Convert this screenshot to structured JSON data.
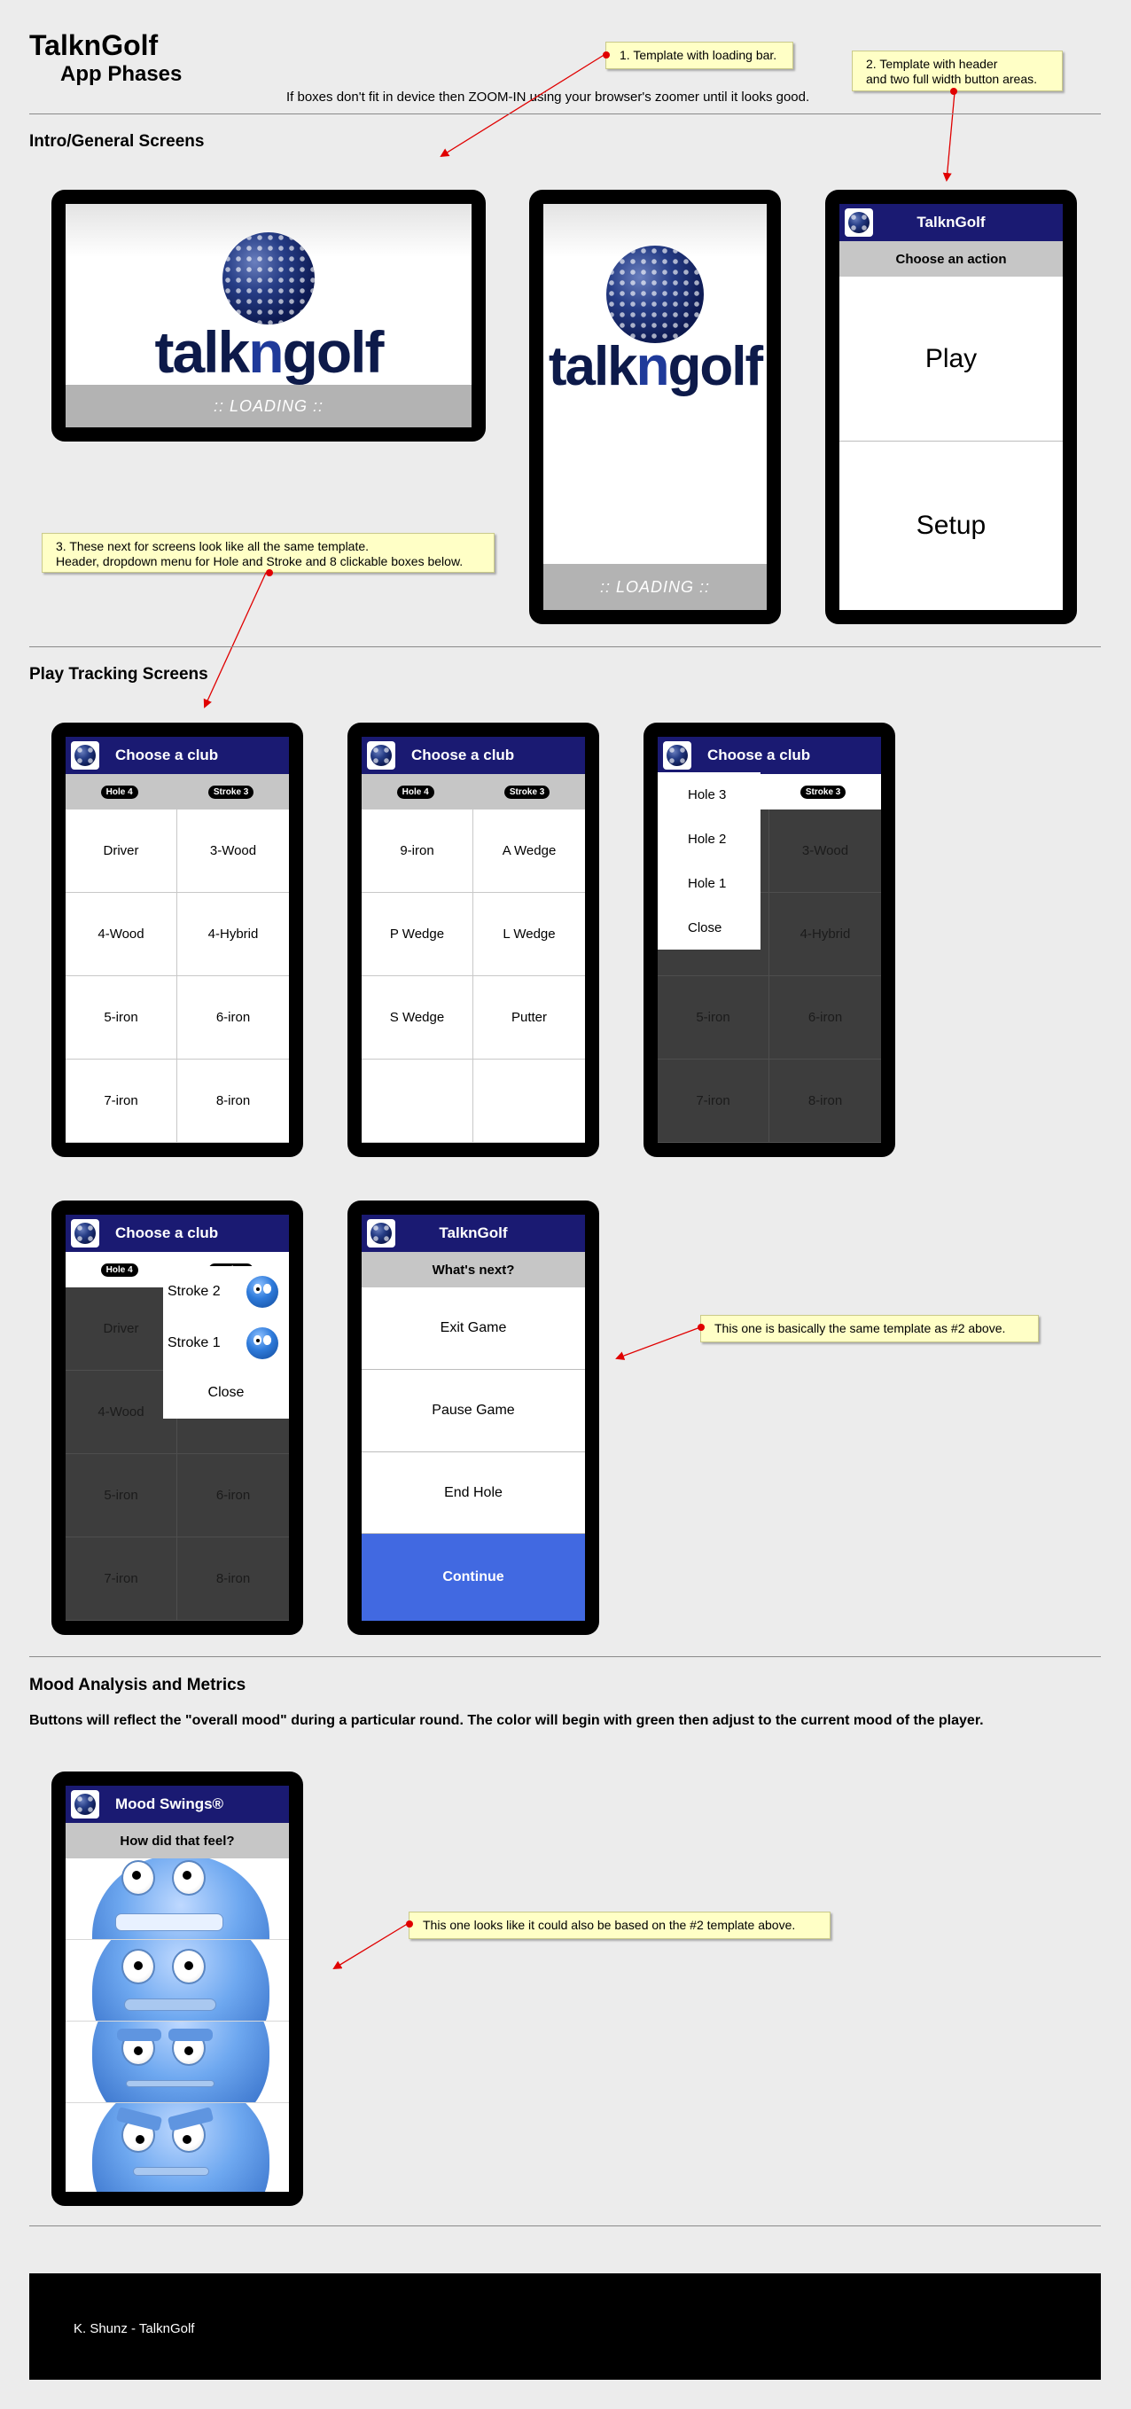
{
  "page": {
    "title": "TalknGolf",
    "subtitle": "App Phases",
    "hint": "If boxes don't fit in device then ZOOM-IN using your browser's zoomer until it looks good."
  },
  "notes": {
    "n1": "1. Template with loading bar.",
    "n2": "2. Template with header\nand two full width button areas.",
    "n3": "3. These next for screens look like all the same template.\nHeader, dropdown menu for Hole and Stroke and 8 clickable boxes below.",
    "n4": "This one is basically the same template as #2 above.",
    "n5": "This one looks like it could also be based on the #2 template above."
  },
  "sections": {
    "intro": "Intro/General Screens",
    "play": "Play Tracking Screens",
    "mood": "Mood Analysis and Metrics",
    "mood_desc": "Buttons will reflect the \"overall mood\" during a particular round. The color will begin with green then adjust to the current mood of the player."
  },
  "logo": {
    "part1": "talk",
    "part2": "n",
    "part3": "golf"
  },
  "loading": ":: LOADING ::",
  "action_screen": {
    "header": "TalknGolf",
    "subheader": "Choose an action",
    "buttons": [
      "Play",
      "Setup"
    ]
  },
  "club_screen": {
    "header": "Choose a club",
    "hole": "Hole 4",
    "stroke": "Stroke 3",
    "clubs_page1": [
      "Driver",
      "3-Wood",
      "4-Wood",
      "4-Hybrid",
      "5-iron",
      "6-iron",
      "7-iron",
      "8-iron"
    ],
    "clubs_page2": [
      "9-iron",
      "A Wedge",
      "P Wedge",
      "L Wedge",
      "S Wedge",
      "Putter",
      "",
      ""
    ],
    "hole_menu": [
      "Hole 3",
      "Hole 2",
      "Hole 1",
      "Close"
    ],
    "stroke_menu": [
      "Stroke 2",
      "Stroke 1",
      "Close"
    ]
  },
  "next_screen": {
    "header": "TalknGolf",
    "subheader": "What's next?",
    "buttons": [
      "Exit Game",
      "Pause Game",
      "End Hole",
      "Continue"
    ]
  },
  "mood_screen": {
    "header": "Mood Swings®",
    "subheader": "How did that feel?",
    "moods": [
      "very-happy-face",
      "happy-face",
      "annoyed-face",
      "angry-face"
    ]
  },
  "colors": {
    "header": "#1a1a72",
    "primary": "#4169e1",
    "note": "#ffffc6",
    "arrow": "#e00000"
  },
  "footer": {
    "text": "K. Shunz - TalknGolf"
  }
}
